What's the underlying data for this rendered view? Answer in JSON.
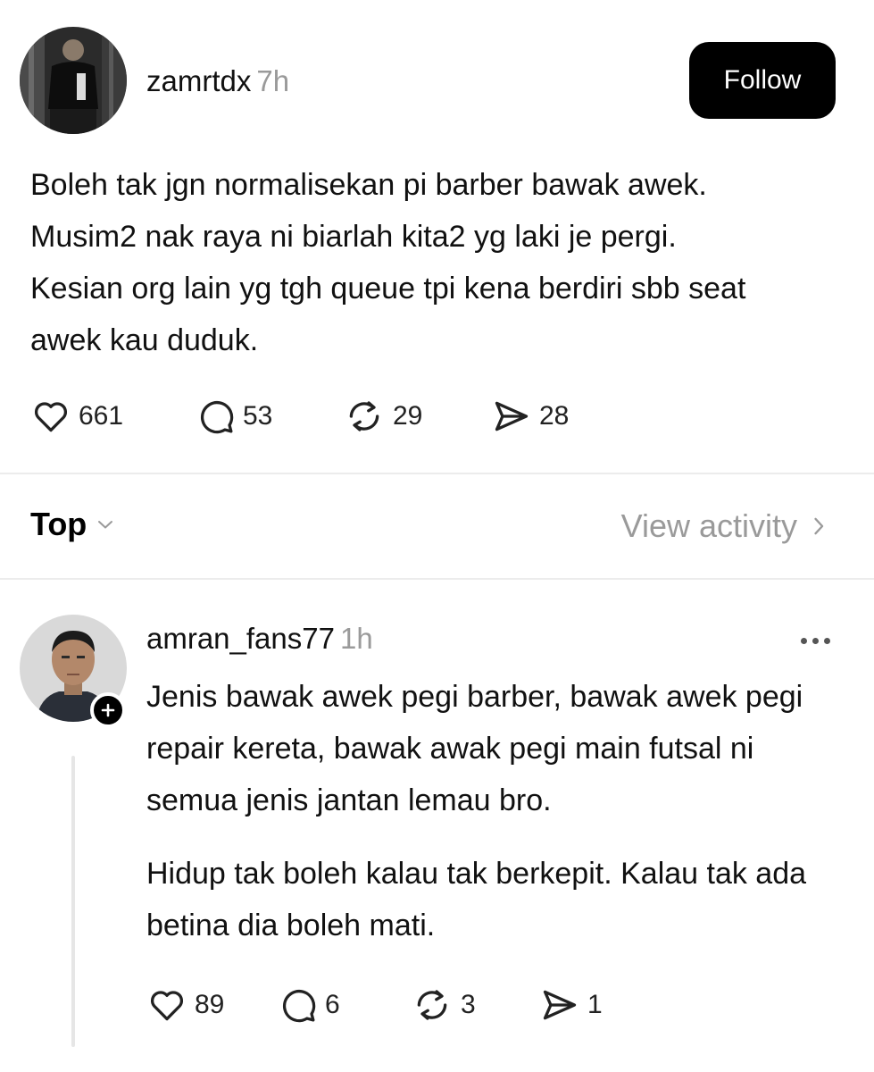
{
  "post": {
    "username": "zamrtdx",
    "time": "7h",
    "follow_label": "Follow",
    "text": "Boleh tak jgn normalisekan pi barber bawak awek. Musim2 nak raya ni biarlah kita2 yg laki je pergi. Kesian org lain yg tgh queue tpi kena berdiri sbb seat awek kau duduk.",
    "stats": {
      "likes": "661",
      "comments": "53",
      "reposts": "29",
      "shares": "28"
    }
  },
  "replies_header": {
    "sort_label": "Top",
    "view_activity_label": "View activity"
  },
  "reply": {
    "username": "amran_fans77",
    "time": "1h",
    "paragraphs": [
      "Jenis bawak awek pegi barber, bawak awek pegi repair kereta, bawak awak pegi main futsal ni semua jenis jantan lemau bro.",
      "Hidup tak boleh kalau tak berkepit. Kalau tak ada betina dia boleh mati."
    ],
    "stats": {
      "likes": "89",
      "comments": "6",
      "reposts": "3",
      "shares": "1"
    }
  },
  "icons": {
    "like": "heart-icon",
    "comment": "comment-bubble-icon",
    "repost": "repost-icon",
    "share": "send-icon",
    "sort": "chevron-down-icon",
    "view_activity": "chevron-right-icon",
    "more": "more-dots-icon",
    "follow_badge": "plus-icon"
  }
}
